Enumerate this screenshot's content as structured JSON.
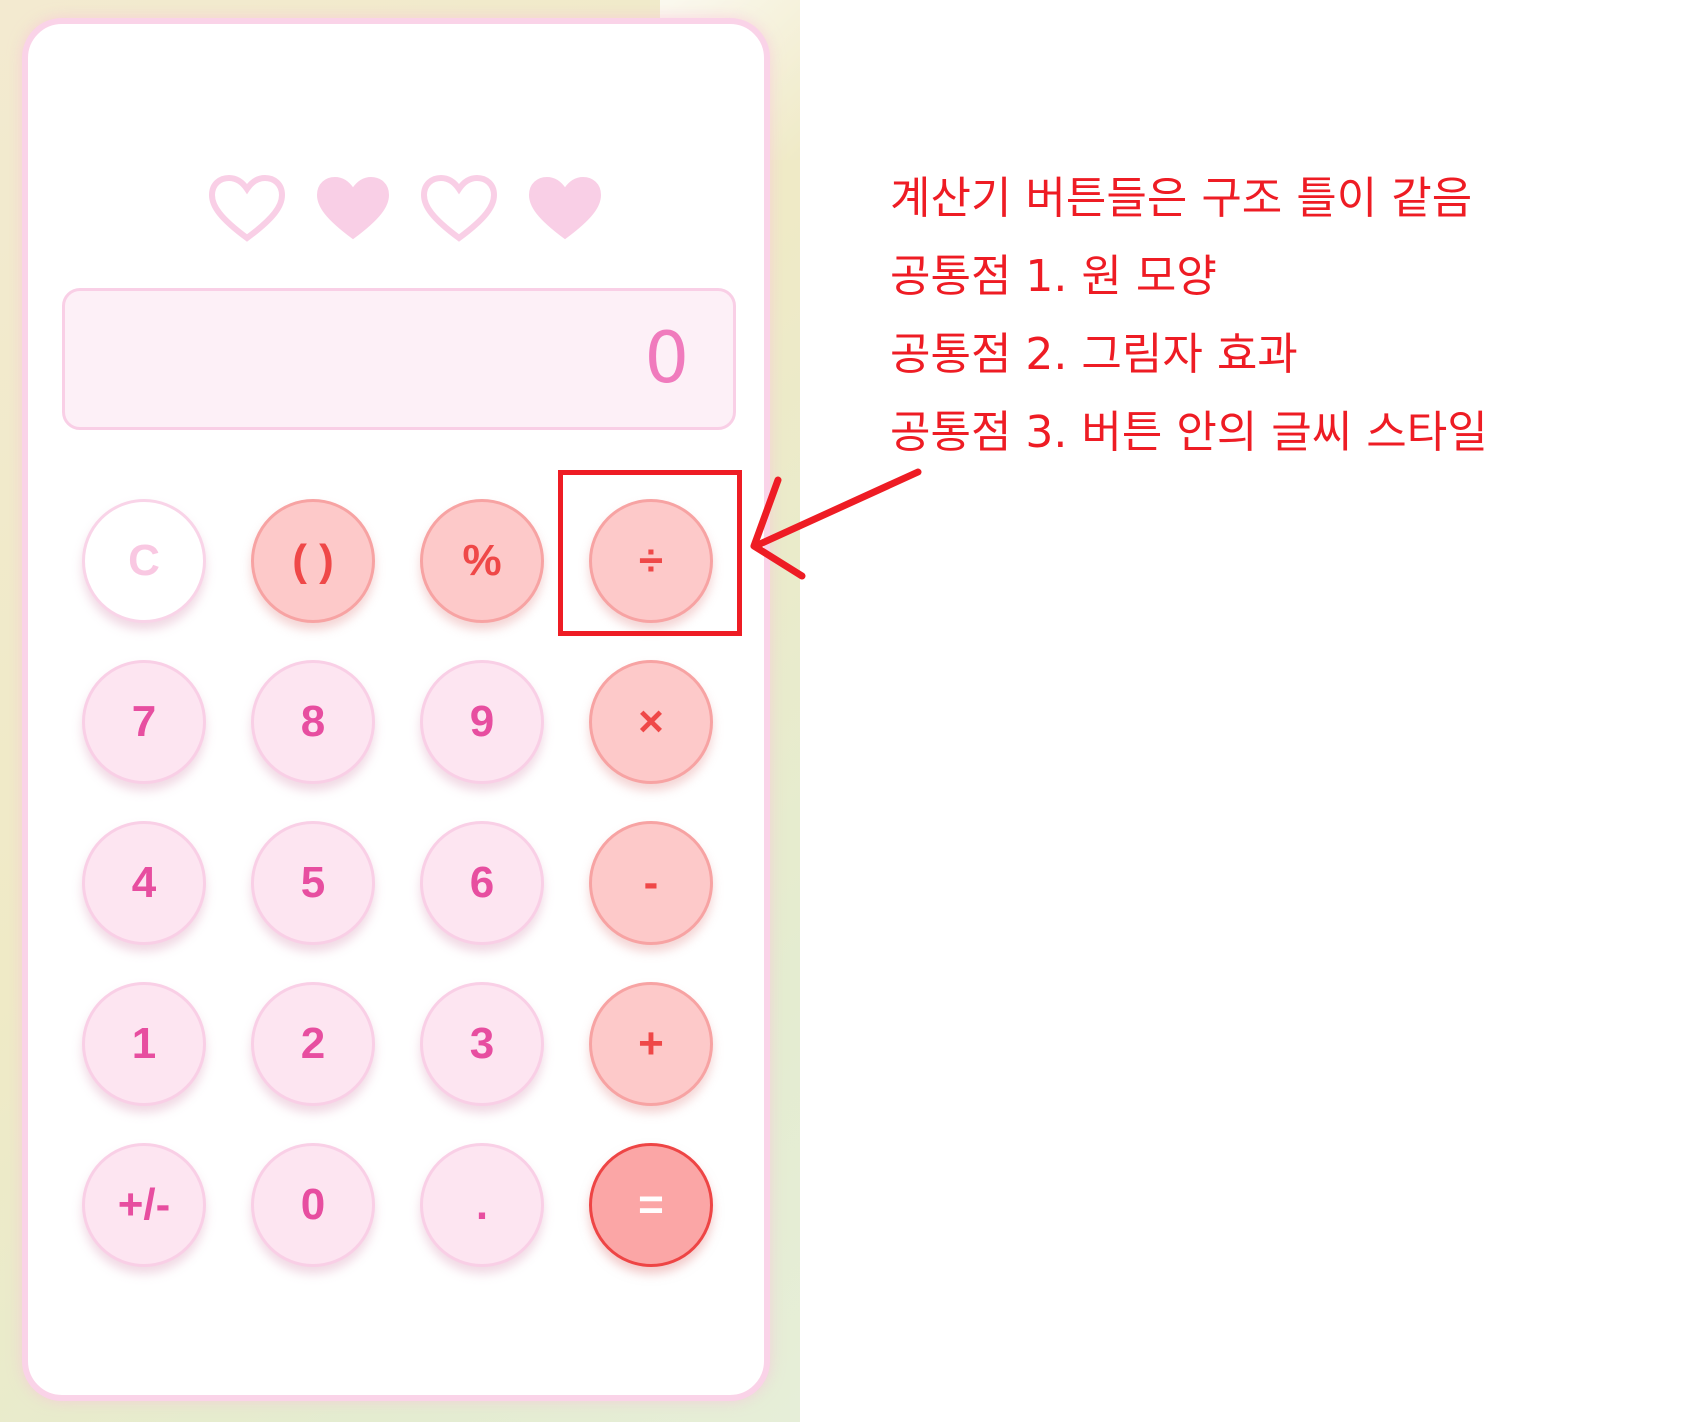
{
  "display": {
    "value": "0"
  },
  "hearts": [
    {
      "name": "heart-outline-icon",
      "filled": false
    },
    {
      "name": "heart-filled-icon",
      "filled": true
    },
    {
      "name": "heart-outline-icon",
      "filled": false
    },
    {
      "name": "heart-filled-icon",
      "filled": true
    }
  ],
  "buttons": [
    {
      "label": "C",
      "kind": "clear",
      "name": "clear-button"
    },
    {
      "label": "( )",
      "kind": "op",
      "name": "parentheses-button"
    },
    {
      "label": "%",
      "kind": "op",
      "name": "percent-button"
    },
    {
      "label": "÷",
      "kind": "op",
      "name": "divide-button"
    },
    {
      "label": "7",
      "kind": "num",
      "name": "digit-7-button"
    },
    {
      "label": "8",
      "kind": "num",
      "name": "digit-8-button"
    },
    {
      "label": "9",
      "kind": "num",
      "name": "digit-9-button"
    },
    {
      "label": "×",
      "kind": "op",
      "name": "multiply-button"
    },
    {
      "label": "4",
      "kind": "num",
      "name": "digit-4-button"
    },
    {
      "label": "5",
      "kind": "num",
      "name": "digit-5-button"
    },
    {
      "label": "6",
      "kind": "num",
      "name": "digit-6-button"
    },
    {
      "label": "-",
      "kind": "op",
      "name": "subtract-button"
    },
    {
      "label": "1",
      "kind": "num",
      "name": "digit-1-button"
    },
    {
      "label": "2",
      "kind": "num",
      "name": "digit-2-button"
    },
    {
      "label": "3",
      "kind": "num",
      "name": "digit-3-button"
    },
    {
      "label": "+",
      "kind": "op",
      "name": "add-button"
    },
    {
      "label": "+/-",
      "kind": "num",
      "name": "sign-toggle-button"
    },
    {
      "label": "0",
      "kind": "num",
      "name": "digit-0-button"
    },
    {
      "label": ".",
      "kind": "num",
      "name": "decimal-button"
    },
    {
      "label": "=",
      "kind": "eq",
      "name": "equals-button"
    }
  ],
  "annotation": {
    "lines": [
      "계산기 버튼들은 구조 틀이 같음",
      "공통점 1. 원 모양",
      "공통점 2. 그림자 효과",
      "공통점 3. 버튼 안의 글씨 스타일"
    ]
  },
  "colors": {
    "heart": "#f9cfe6",
    "annotation": "#ee1c24",
    "number_button_bg": "#fde5f1",
    "operator_button_bg": "#fdc9c9",
    "equals_button_bg": "#fba6a6",
    "display_text": "#f07bbd"
  }
}
